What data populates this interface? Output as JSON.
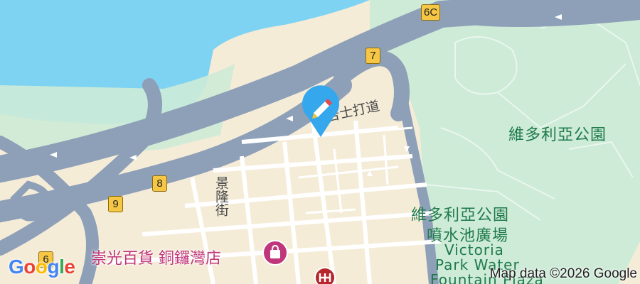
{
  "map": {
    "labels": {
      "gloucester_road": "告士打道",
      "king_street": "景隆街",
      "victoria_park": "維多利亞公園",
      "fountain_plaza_zh_1": "維多利亞公園",
      "fountain_plaza_zh_2": "噴水池廣場",
      "fountain_plaza_en_1": "Victoria",
      "fountain_plaza_en_2": "Park Water",
      "fountain_plaza_en_3": "Fountain Plaza",
      "sogo": "崇光百貨 銅鑼灣店"
    },
    "route_shields": [
      "6C",
      "7",
      "8",
      "9",
      "6"
    ],
    "attribution": "Map data ©2026 Google",
    "logo": [
      "G",
      "o",
      "o",
      "g",
      "l",
      "e"
    ],
    "colors": {
      "water": "#7fd3f2",
      "park": "#cdebd7",
      "land": "#f5ecd8",
      "highway": "#8e9fb8",
      "road": "#ffffff",
      "pin": "#35a7ec",
      "poi": "#c0367a"
    }
  }
}
